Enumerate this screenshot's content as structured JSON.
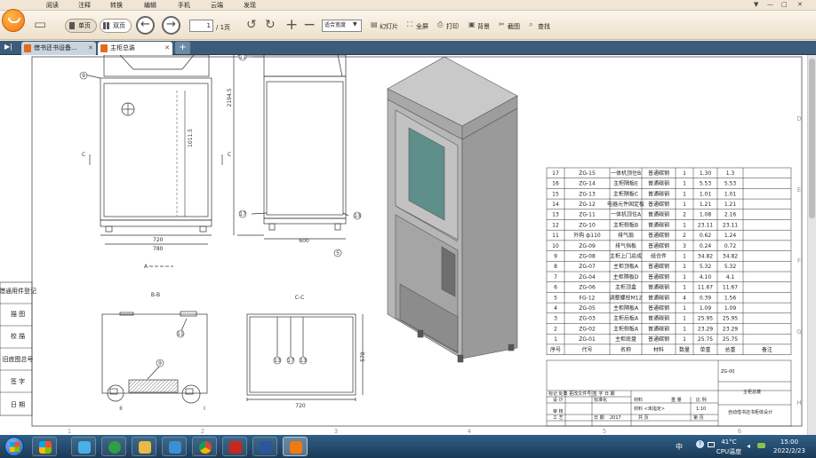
{
  "menu": {
    "items": [
      "阅读",
      "注释",
      "转换",
      "编辑",
      "手机",
      "云端",
      "发现"
    ]
  },
  "window_controls": [
    "▼",
    "—",
    "□",
    "✕"
  ],
  "toolbar": {
    "single_page": "单页",
    "double_page": "双页",
    "page_current": "1",
    "page_total": "/ 1页",
    "zoom": "适合宽度",
    "slideshow": "幻灯片",
    "fullscreen": "全屏",
    "print": "打印",
    "background": "背景",
    "screenshot": "截图",
    "search": "查找"
  },
  "tabs": [
    {
      "label": "借书还书设备...",
      "close": "✕"
    },
    {
      "label": "主柜总装",
      "close": "✕"
    }
  ],
  "tab_add": "+",
  "drawing": {
    "title_block_labels": [
      "借通用件登记",
      "描 图",
      "校 描",
      "旧底图总号",
      "签 字",
      "日 期"
    ],
    "column_marks": [
      "1",
      "2",
      "3",
      "4",
      "5",
      "6"
    ],
    "row_marks": [
      "C",
      "D",
      "E",
      "F",
      "G",
      "H"
    ],
    "view_labels": {
      "bb": "B-B",
      "cc": "C-C",
      "a_arrow": "A",
      "c_left": "C",
      "c_right": "C"
    },
    "dims": {
      "d1011": "1011.5",
      "d2194": "2194.5",
      "d720": "720",
      "d780": "780",
      "d600": "600",
      "d578": "578",
      "d720b": "720"
    },
    "balloons": [
      "9",
      "11",
      "17",
      "13",
      "5",
      "11",
      "9",
      "13",
      "17",
      "13"
    ],
    "details": [
      "II",
      "I"
    ],
    "bom_header": [
      "序号",
      "代号",
      "名称",
      "材料",
      "数量",
      "单重",
      "总重",
      "备注"
    ],
    "bom_rows": [
      [
        "17",
        "ZG-15",
        "一体机顶住B",
        "普通碳钢",
        "1",
        "1.30",
        "1.3",
        ""
      ],
      [
        "16",
        "ZG-14",
        "主柜隔板E",
        "普通碳钢",
        "1",
        "5.53",
        "5.53",
        ""
      ],
      [
        "15",
        "ZG-13",
        "主柜隔板C",
        "普通碳钢",
        "1",
        "1.01",
        "1.01",
        ""
      ],
      [
        "14",
        "ZG-12",
        "电器元件固定板",
        "普通碳钢",
        "1",
        "1.21",
        "1.21",
        ""
      ],
      [
        "13",
        "ZG-11",
        "一体机顶住A",
        "普通碳钢",
        "2",
        "1.08",
        "2.16",
        ""
      ],
      [
        "12",
        "ZG-10",
        "主柜侧板B",
        "普通碳钢",
        "1",
        "23.11",
        "23.11",
        ""
      ],
      [
        "11",
        "外购 ф110",
        "排气扇",
        "普通碳钢",
        "2",
        "0.62",
        "1.24",
        ""
      ],
      [
        "10",
        "ZG-09",
        "排气挡板",
        "普通碳钢",
        "3",
        "0.24",
        "0.72",
        ""
      ],
      [
        "9",
        "ZG-08",
        "主柜上门总成",
        "组合件",
        "1",
        "34.82",
        "34.82",
        ""
      ],
      [
        "8",
        "ZG-07",
        "主柜顶板A",
        "普通碳钢",
        "1",
        "5.32",
        "5.32",
        ""
      ],
      [
        "7",
        "ZG-04",
        "主柜隔板D",
        "普通碳钢",
        "1",
        "4.10",
        "4.1",
        ""
      ],
      [
        "6",
        "ZG-06",
        "主柜顶盒",
        "普通碳钢",
        "1",
        "11.67",
        "11.67",
        ""
      ],
      [
        "5",
        "FG-12",
        "调整螺栓M12",
        "普通碳钢",
        "4",
        "0.39",
        "1.56",
        ""
      ],
      [
        "4",
        "ZG-05",
        "主柜隔板A",
        "普通碳钢",
        "1",
        "1.09",
        "1.09",
        ""
      ],
      [
        "3",
        "ZG-03",
        "主柜后板A",
        "普通碳钢",
        "1",
        "25.95",
        "25.95",
        ""
      ],
      [
        "2",
        "ZG-02",
        "主柜侧板A",
        "普通碳钢",
        "1",
        "23.29",
        "23.29",
        ""
      ],
      [
        "1",
        "ZG-01",
        "主柜底盘",
        "普通碳钢",
        "1",
        "25.75",
        "25.75",
        ""
      ]
    ],
    "title_block": {
      "drawing_no": "ZG-00",
      "part_name": "主柜总装",
      "project": "自动借书还书柜体设计",
      "material": "材料 <未指定>",
      "scale_label": "比 例",
      "scale": "1:10",
      "weight_label": "重 量",
      "material_label": "材料",
      "marks": "标记 处数 更改文件号 签 字 日 期",
      "design": "设 计",
      "standard": "标准化",
      "review": "审 核",
      "process": "工 艺",
      "date_label": "日 期",
      "year": "2017",
      "total_label": "共 页",
      "page_label": "第 页"
    }
  },
  "taskbar": {
    "apps": [
      "start",
      "windows-flag",
      "explorer",
      "ie",
      "folder",
      "photos",
      "chrome",
      "solidworks",
      "word",
      "reader"
    ],
    "temp": "41°C",
    "cpu": "CPU温度",
    "time": "15:00",
    "date": "2022/2/23",
    "lang_icon": "中"
  },
  "colors": {
    "accent": "#f07a12",
    "tabbar": "#3b5d79",
    "taskbar": "#1f4666",
    "cabinet": "#b9b9b9",
    "glass": "#5e8f8a"
  }
}
